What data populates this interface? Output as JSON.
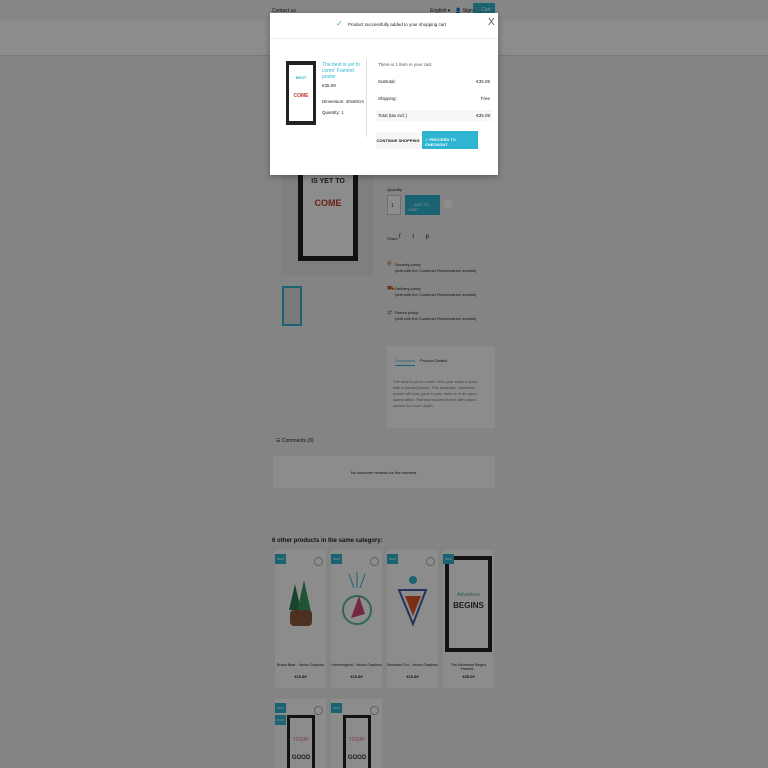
{
  "topbar": {
    "contact": "Contact us",
    "language": "English ▾",
    "signin": "Sign in",
    "cart": "Cart (1)"
  },
  "product": {
    "poster_line1": "IS YET TO",
    "poster_line2": "COME",
    "quantity_label": "Quantity",
    "quantity_value": "1",
    "add_to_cart": "ADD TO CART",
    "share_label": "Share",
    "share_icons": "f t p"
  },
  "reassurance": [
    {
      "title": "Security policy",
      "desc": "(edit with the Customer Reassurance module)"
    },
    {
      "title": "Delivery policy",
      "desc": "(edit with the Customer Reassurance module)"
    },
    {
      "title": "Return policy",
      "desc": "(edit with the Customer Reassurance module)"
    }
  ],
  "tabs": {
    "description": "Description",
    "details": "Product Details",
    "description_text": "The best is yet to come! Give your walls a voice with a framed poster. This aesthetic, optimistic poster will look great in your desk or in an open-space office. Painted wooden frame with passe-partout for more depth."
  },
  "comments": {
    "heading": "Comments (0)",
    "empty": "No customer reviews for the moment."
  },
  "related": {
    "title": "6 other products in the same category:",
    "new_badge": "NEW",
    "pack_badge": "PACK",
    "items": [
      {
        "name": "Brown Bear - Vector Graphics",
        "price": "€10.89"
      },
      {
        "name": "Hummingbird - Vector Graphics",
        "price": "€10.89"
      },
      {
        "name": "Mountain Fox - Vector Graphics",
        "price": "€10.89"
      },
      {
        "name": "The Adventure Begins Framed...",
        "price": "€35.09"
      },
      {
        "name": "Today is a good day",
        "price": ""
      },
      {
        "name": "Today is a good day",
        "price": ""
      }
    ]
  },
  "modal": {
    "message": "Product successfully added to your shopping cart",
    "close": "X",
    "product_name": "The best is yet to come' Framed poster",
    "product_price": "€35.09",
    "dimension": "Dimension: 40x60cm",
    "quantity": "Quantity: 1",
    "cart_count": "There is 1 item in your cart.",
    "subtotal_label": "Subtotal:",
    "subtotal_value": "€35.09",
    "shipping_label": "Shipping:",
    "shipping_value": "Free",
    "total_label": "Total (tax incl.)",
    "total_value": "€35.09",
    "continue": "CONTINUE SHOPPING",
    "checkout": "PROCEED TO CHECKOUT",
    "poster_text1": "BEST",
    "poster_text2": "COME"
  }
}
